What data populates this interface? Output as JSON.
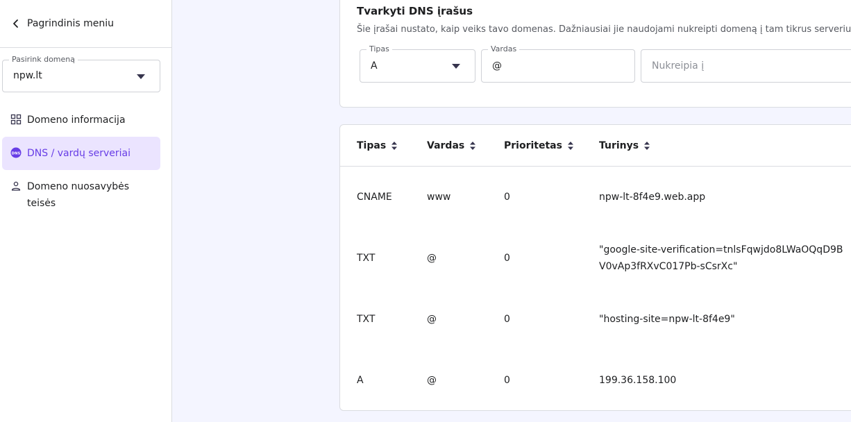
{
  "sidebar": {
    "back_label": "Pagrindinis meniu",
    "domain_select": {
      "label": "Pasirink domeną",
      "value": "npw.lt"
    },
    "items": [
      {
        "label": "Domeno informacija",
        "icon": "dashboard-grid-icon"
      },
      {
        "label": "DNS / vardų serveriai",
        "icon": "dns-icon",
        "active": true
      },
      {
        "label": "Domeno nuosavybės teisės",
        "icon": "person-icon"
      }
    ]
  },
  "dns_form": {
    "title": "Tvarkyti DNS įrašus",
    "description": "Šie įrašai nustato, kaip veiks tavo domenas. Dažniausiai jie naudojami nukreipti domeną į tam tikrus serverius ar",
    "type_field": {
      "label": "Tipas",
      "value": "A"
    },
    "name_field": {
      "label": "Vardas",
      "value": "@"
    },
    "target_field": {
      "placeholder": "Nukreipia į"
    }
  },
  "records": {
    "columns": [
      "Tipas",
      "Vardas",
      "Prioritetas",
      "Turinys"
    ],
    "rows": [
      {
        "type": "CNAME",
        "name": "www",
        "priority": "0",
        "content": "npw-lt-8f4e9.web.app"
      },
      {
        "type": "TXT",
        "name": "@",
        "priority": "0",
        "content": "\"google-site-verification=tnlsFqwjdo8LWaOQqD9BV0vAp3fRXvC017Pb-sCsrXc\""
      },
      {
        "type": "TXT",
        "name": "@",
        "priority": "0",
        "content": "\"hosting-site=npw-lt-8f4e9\""
      },
      {
        "type": "A",
        "name": "@",
        "priority": "0",
        "content": "199.36.158.100"
      }
    ]
  },
  "colors": {
    "accent": "#673de6",
    "active_bg": "#ebe4ff",
    "page_bg": "#f4f5ff",
    "border": "#dadce0"
  }
}
